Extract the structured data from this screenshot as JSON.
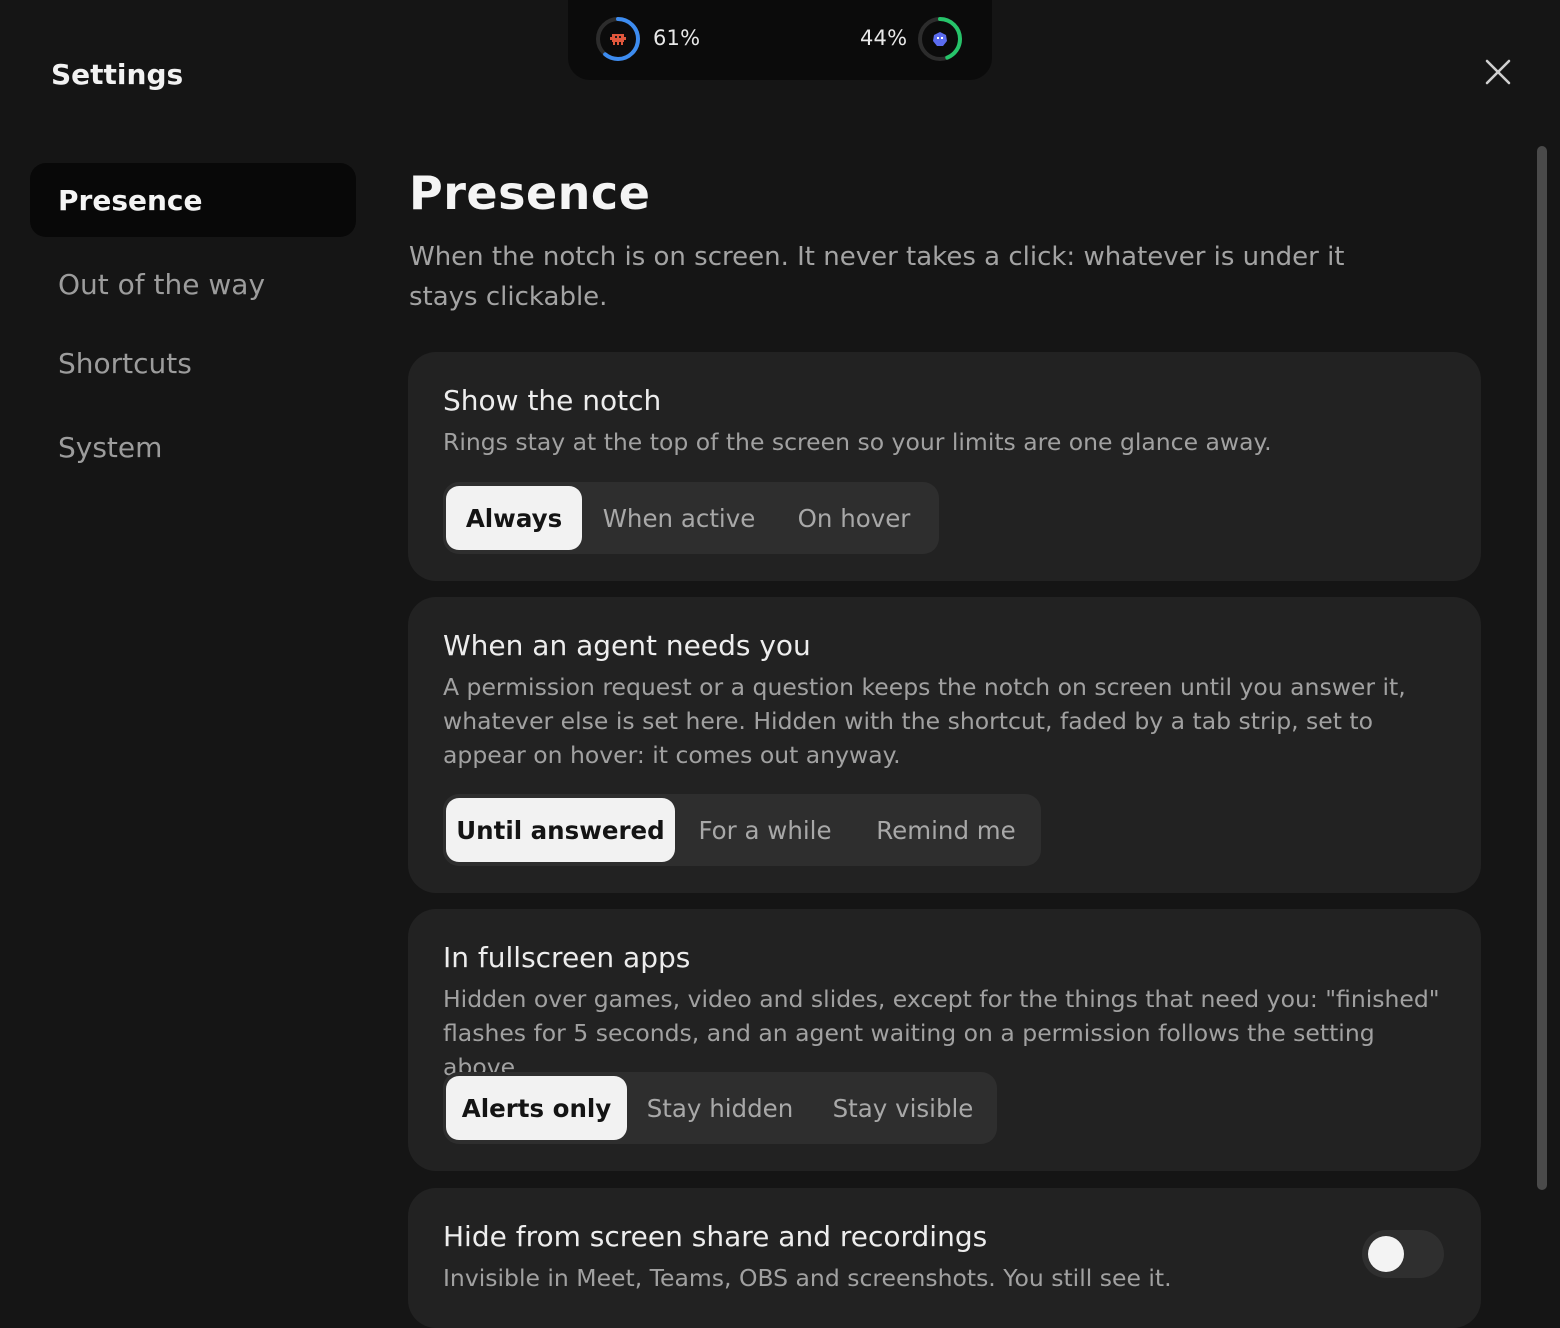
{
  "notch": {
    "left": {
      "percent_label": "61%",
      "level": 0.61,
      "color": "#3d8cf0",
      "icon": "red-pixel-creature-icon"
    },
    "right": {
      "percent_label": "44%",
      "level": 0.44,
      "color": "#26c46a",
      "icon": "blue-pixel-creature-icon"
    }
  },
  "window": {
    "title": "Settings",
    "close_icon": "close-icon"
  },
  "sidebar": {
    "items": [
      {
        "label": "Presence",
        "active": true
      },
      {
        "label": "Out of the way",
        "active": false
      },
      {
        "label": "Shortcuts",
        "active": false
      },
      {
        "label": "System",
        "active": false
      }
    ]
  },
  "main": {
    "heading": "Presence",
    "intro": "When the notch is on screen. It never takes a click: whatever is under it stays clickable.",
    "sections": [
      {
        "title": "Show the notch",
        "description": "Rings stay at the top of the screen so your limits are one glance away.",
        "options": [
          "Always",
          "When active",
          "On hover"
        ],
        "selected": "Always"
      },
      {
        "title": "When an agent needs you",
        "description": "A permission request or a question keeps the notch on screen until you answer it, whatever else is set here. Hidden with the shortcut, faded by a tab strip, set to appear on hover: it comes out anyway.",
        "options": [
          "Until answered",
          "For a while",
          "Remind me"
        ],
        "selected": "Until answered"
      },
      {
        "title": "In fullscreen apps",
        "description": "Hidden over games, video and slides, except for the things that need you: \"finished\" flashes for 5 seconds, and an agent waiting on a permission follows the setting above.",
        "options": [
          "Alerts only",
          "Stay hidden",
          "Stay visible"
        ],
        "selected": "Alerts only"
      },
      {
        "title": "Hide from screen share and recordings",
        "description": "Invisible in Meet, Teams, OBS and screenshots. You still see it.",
        "toggle_on": false
      }
    ]
  },
  "colors": {
    "background": "#151515",
    "card": "#222222",
    "accent_blue": "#3d8cf0",
    "accent_green": "#26c46a"
  }
}
